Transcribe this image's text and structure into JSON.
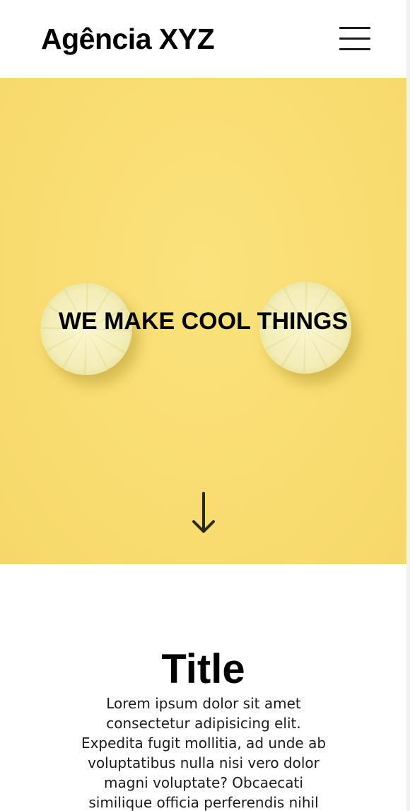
{
  "header": {
    "brand": "Agência XYZ",
    "menu_icon": "hamburger-menu-icon"
  },
  "hero": {
    "title": "WE MAKE COOL THINGS",
    "background_color": "#f9dd72",
    "background_image": "two lemon slices on yellow background",
    "scroll_icon": "arrow-down-icon"
  },
  "content": {
    "title": "Title",
    "text": "Lorem ipsum dolor sit amet consectetur adipisicing elit. Expedita fugit mollitia, ad unde ab voluptatibus nulla nisi vero dolor magni voluptate? Obcaecati similique officia perferendis nihil"
  }
}
